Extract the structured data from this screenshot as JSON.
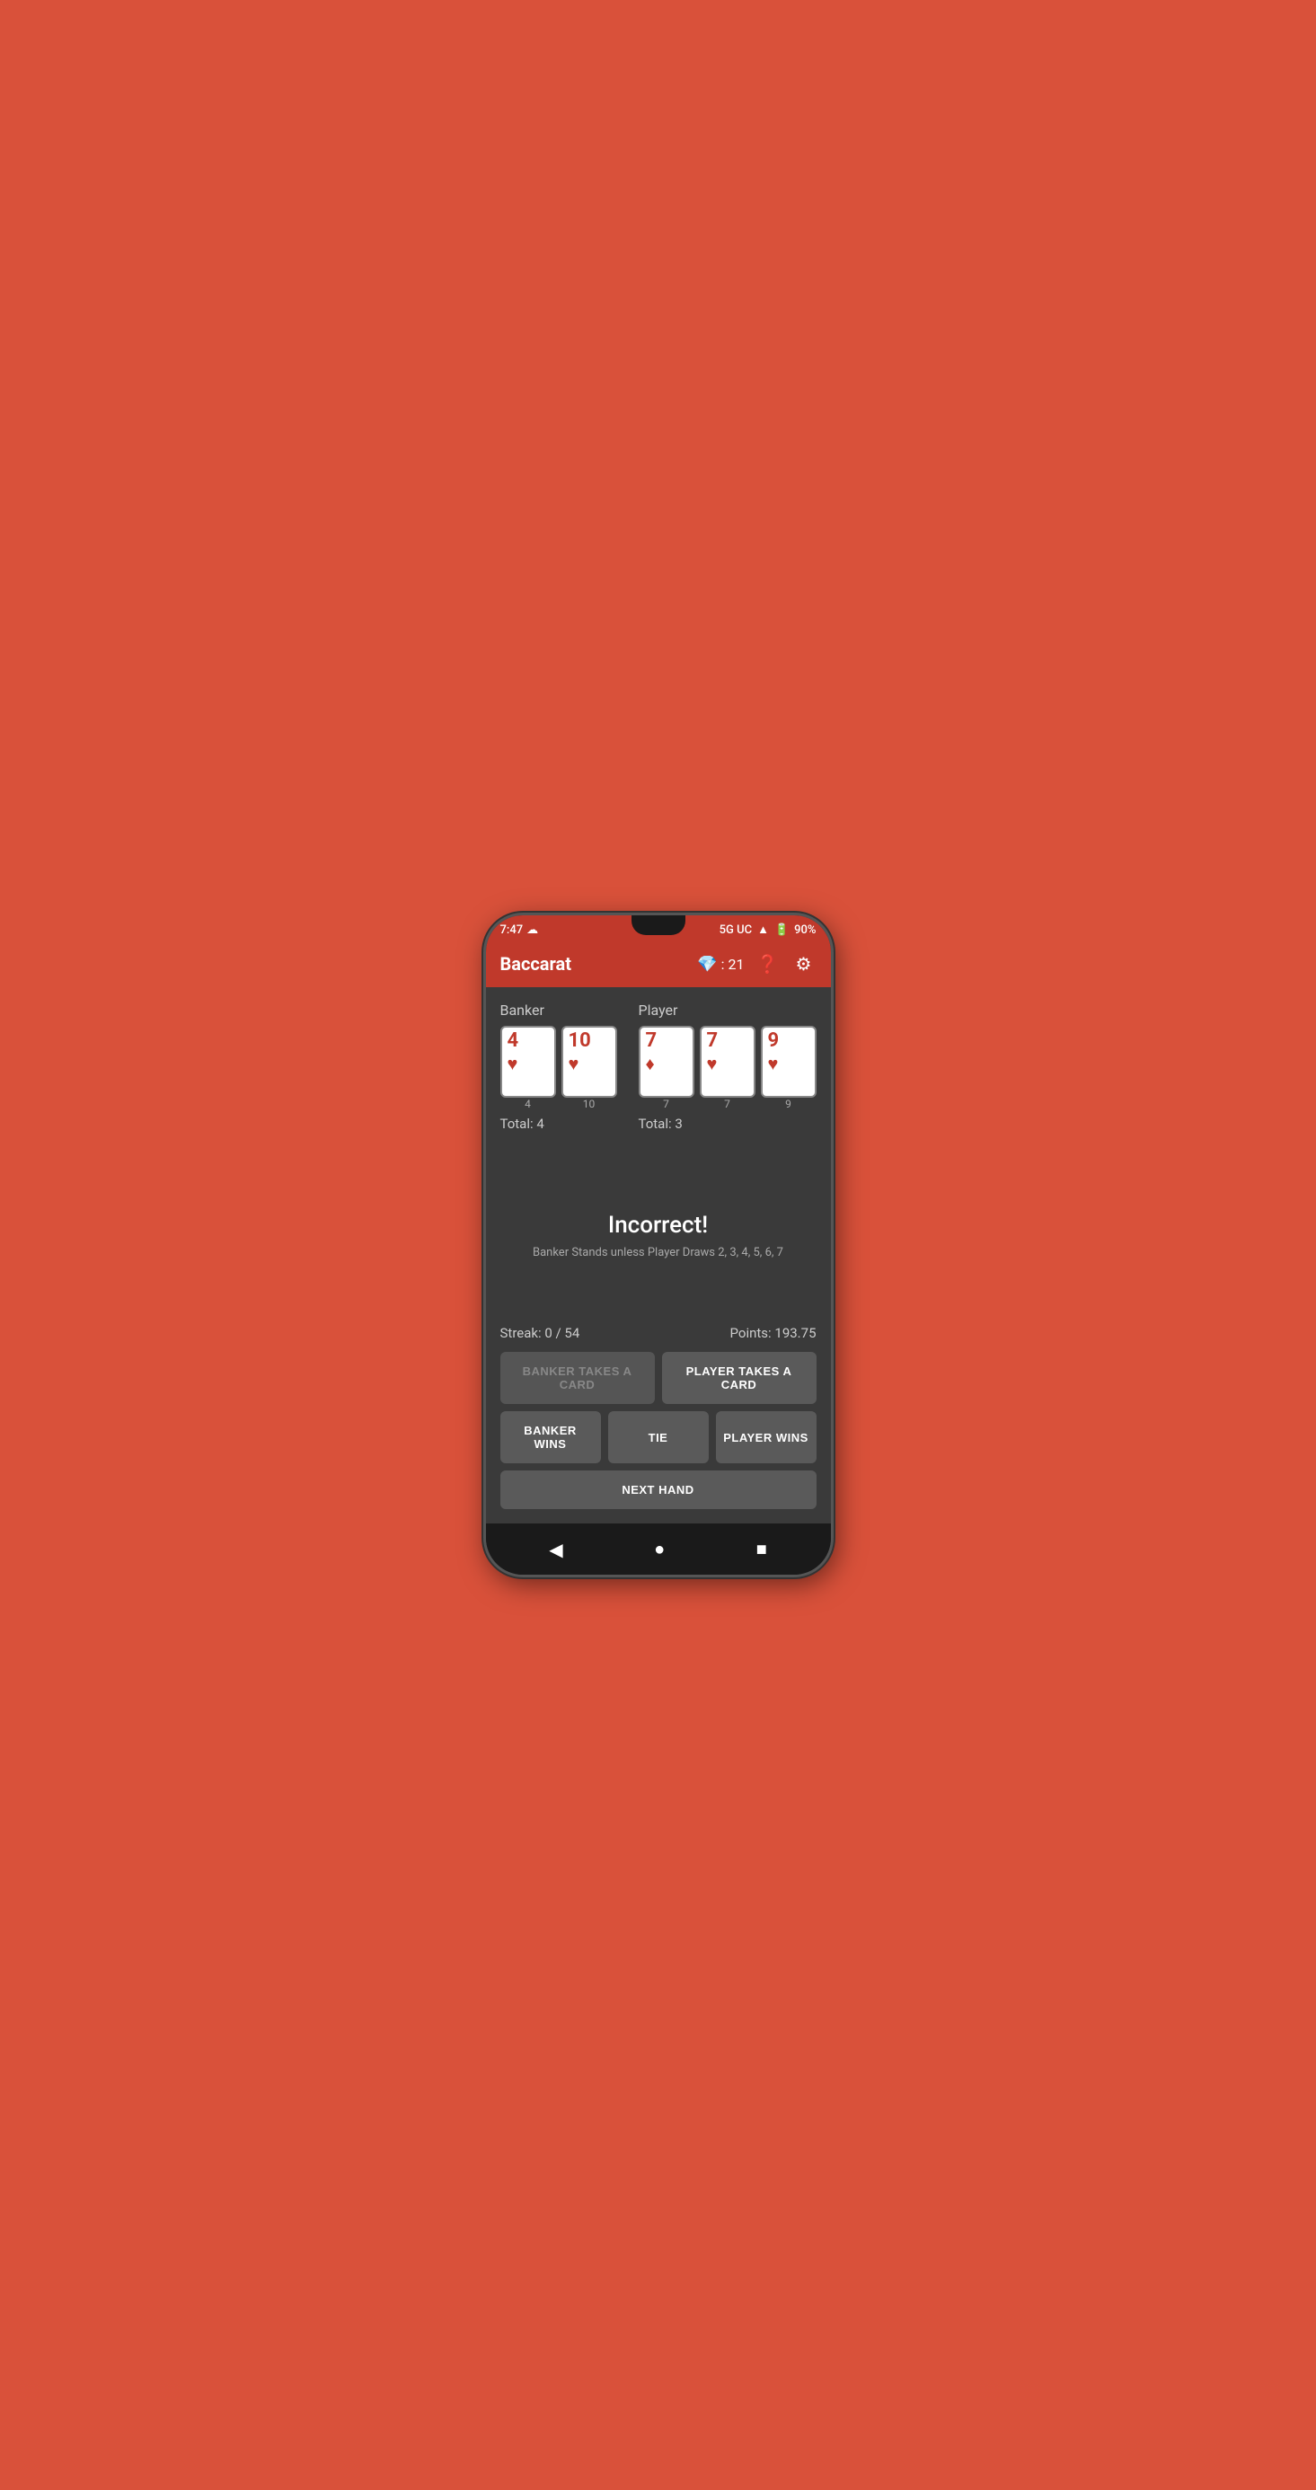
{
  "status_bar": {
    "time": "7:47",
    "network": "5G UC",
    "battery": "90%",
    "cloud_icon": "☁"
  },
  "app_bar": {
    "title": "Baccarat",
    "gem_count": "21",
    "help_icon": "?",
    "settings_icon": "⚙"
  },
  "banker": {
    "label": "Banker",
    "cards": [
      {
        "value": "4",
        "suit": "♥",
        "suit_color": "red",
        "label": "4"
      },
      {
        "value": "10",
        "suit": "♥",
        "suit_color": "red",
        "label": "10"
      }
    ],
    "total_label": "Total: 4"
  },
  "player": {
    "label": "Player",
    "cards": [
      {
        "value": "7",
        "suit": "♦",
        "suit_color": "red",
        "label": "7"
      },
      {
        "value": "7",
        "suit": "♥",
        "suit_color": "red",
        "label": "7"
      },
      {
        "value": "9",
        "suit": "♥",
        "suit_color": "red",
        "label": "9"
      }
    ],
    "total_label": "Total: 3"
  },
  "message": {
    "title": "Incorrect!",
    "subtitle": "Banker Stands unless Player Draws 2, 3, 4, 5, 6, 7"
  },
  "stats": {
    "streak": "Streak: 0 / 54",
    "points": "Points: 193.75"
  },
  "buttons": {
    "banker_takes_card": "BANKER TAKES A CARD",
    "player_takes_card": "PLAYER TAKES A CARD",
    "banker_wins": "BANKER WINS",
    "tie": "TIE",
    "player_wins": "PLAYER WINS",
    "next_hand": "NEXT HAND"
  }
}
